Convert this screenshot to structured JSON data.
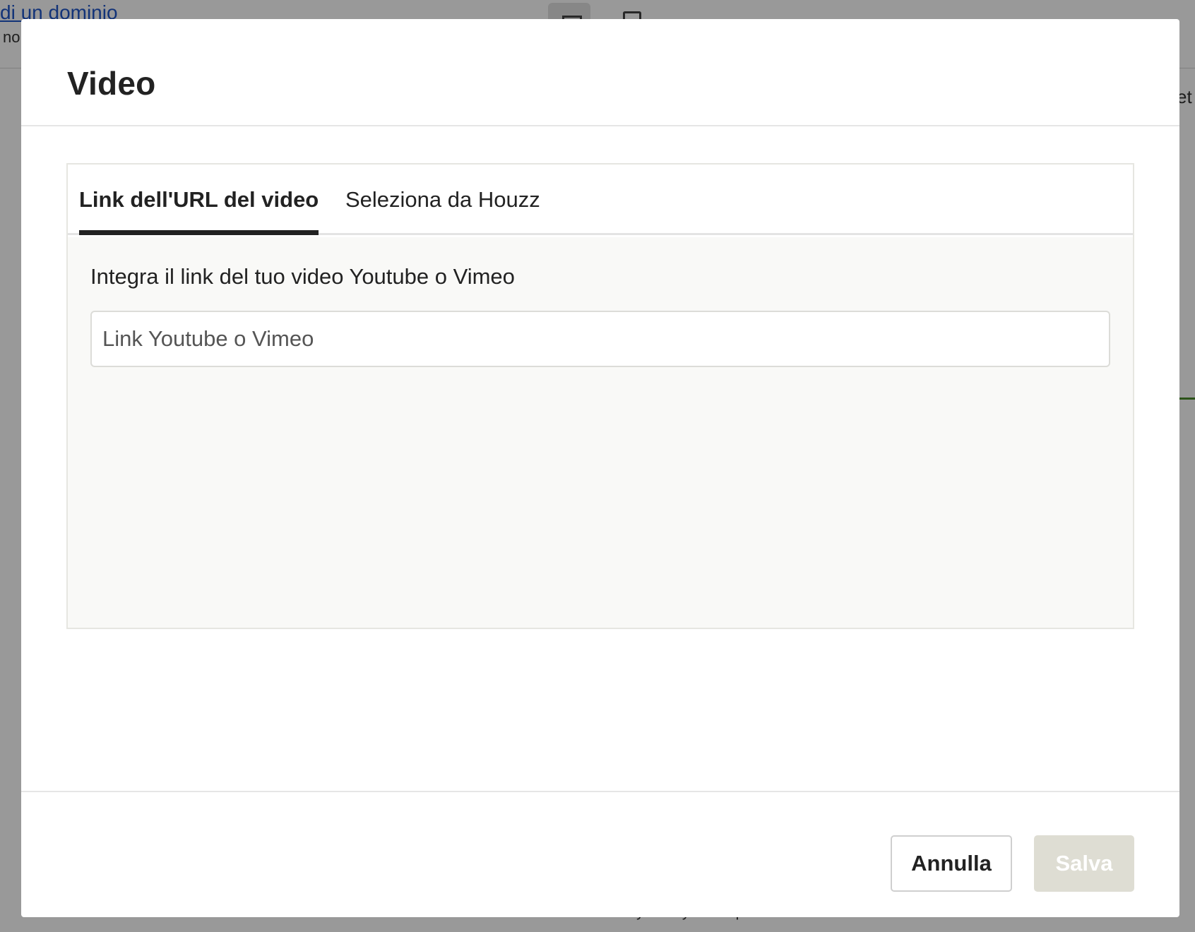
{
  "background": {
    "link_text": "di un dominio",
    "sub_text": "no",
    "right_text": "et",
    "footer": [
      "Privacy Policy",
      "Impostazioni dei cookie"
    ]
  },
  "modal": {
    "title": "Video",
    "tabs": [
      {
        "label": "Link dell'URL del video",
        "active": true
      },
      {
        "label": "Seleziona da Houzz",
        "active": false
      }
    ],
    "embed_label": "Integra il link del tuo video Youtube o Vimeo",
    "url_input": {
      "value": "",
      "placeholder": "Link Youtube o Vimeo"
    },
    "buttons": {
      "cancel_label": "Annulla",
      "save_label": "Salva"
    }
  },
  "colors": {
    "accent_dark": "#222222",
    "save_disabled_bg": "#deddd3",
    "link_blue": "#1f55c8"
  }
}
